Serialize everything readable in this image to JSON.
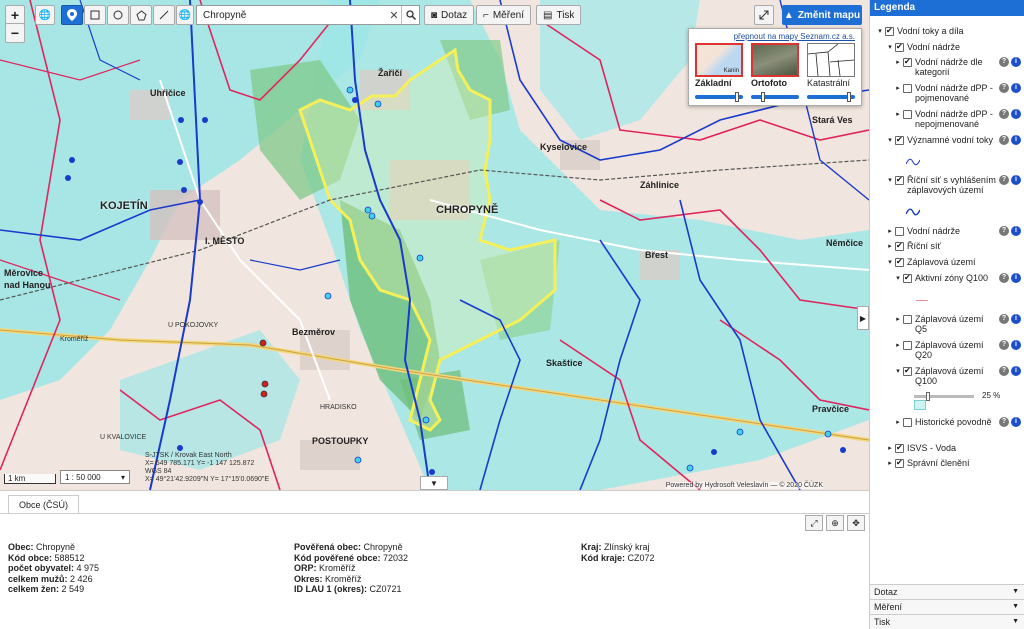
{
  "toolbar": {
    "zoom_in": "+",
    "zoom_out": "−",
    "search_value": "Chropyně",
    "query_label": "Dotaz",
    "measure_label": "Měření",
    "print_label": "Tisk",
    "change_map_label": "Změnit mapu"
  },
  "basemap": {
    "switch_link": "přepnout na mapy Seznam.cz a.s.",
    "options": [
      {
        "label": "Základní",
        "selected": true
      },
      {
        "label": "Ortofoto",
        "selected": true
      },
      {
        "label": "Katastrální",
        "selected": false
      }
    ],
    "thumb_text": "Kanin"
  },
  "map_labels": {
    "kojetin": "KOJETÍN",
    "chropyne": "CHROPYNĚ",
    "zarici": "Žařičí",
    "uhrickce": "Uhřičice",
    "kyselovice": "Kyselovice",
    "zalkovice": "Záhlinice",
    "brest": "Břest",
    "bezmerov": "Bezměrov",
    "postoupky": "POSTOUPKY",
    "kresnovice": "Kroměříž",
    "stara_ves": "Stará Ves",
    "nemcice": "Němčice",
    "pravcice": "Pravčice",
    "skastice": "Skaštice",
    "i_mesto": "I. MĚSTO",
    "merovice": "Měrovice",
    "hanou": "nad Hanou",
    "u_pokojovky": "U POKOJOVKY",
    "kvalovice": "U KVALOVICE",
    "postoupky_small": "Postoupky",
    "hradisko": "HRADISKO"
  },
  "map_status": {
    "scale_bar": "1 km",
    "scale_value": "1 : 50 000",
    "coord_line1": "S-JTSK / Krovak East North",
    "coord_line2": "X= 549 785.171 Y= -1 147 125.872",
    "coord_line3": "WGS 84",
    "coord_line4": "X= 49°21'42.9209\"N Y= 17°15'0.0690\"E",
    "attribution": "Powered by Hydrosoft Veleslavín — © 2020 ČÚZK"
  },
  "info_panel": {
    "tab_label": "Obce (ČSÚ)",
    "col1": [
      {
        "key": "Obec:",
        "value": "Chropyně"
      },
      {
        "key": "Kód obce:",
        "value": "588512"
      },
      {
        "key": "počet obyvatel:",
        "value": "4 975"
      },
      {
        "key": "celkem mužů:",
        "value": "2 426"
      },
      {
        "key": "celkem žen:",
        "value": "2 549"
      }
    ],
    "col2": [
      {
        "key": "Pověřená obec:",
        "value": "Chropyně"
      },
      {
        "key": "Kód pověřené obce:",
        "value": "72032"
      },
      {
        "key": "ORP:",
        "value": "Kroměříž"
      },
      {
        "key": "Okres:",
        "value": "Kroměříž"
      },
      {
        "key": "ID LAU 1 (okres):",
        "value": "CZ0721"
      }
    ],
    "col3": [
      {
        "key": "Kraj:",
        "value": "Zlínský kraj"
      },
      {
        "key": "Kód kraje:",
        "value": "CZ072"
      }
    ]
  },
  "legend": {
    "title": "Legenda",
    "items": [
      {
        "label": "Vodní toky a díla",
        "checked": true
      },
      {
        "label": "Vodní nádrže",
        "checked": true
      },
      {
        "label": "Vodní nádrže dle kategorií",
        "checked": true
      },
      {
        "label": "Vodní nádrže dPP - pojmenované",
        "checked": false
      },
      {
        "label": "Vodní nádrže dPP - nepojmenované",
        "checked": false
      },
      {
        "label": "Významné vodní toky",
        "checked": true
      },
      {
        "label": "Říční síť s vyhlášením záplavových území",
        "checked": true
      },
      {
        "label": "Vodní nádrže",
        "checked": false
      },
      {
        "label": "Říční síť",
        "checked": true
      },
      {
        "label": "Záplavová území",
        "checked": true
      },
      {
        "label": "Aktivní zóny Q100",
        "checked": true
      },
      {
        "label": "Záplavová území Q5",
        "checked": false
      },
      {
        "label": "Záplavová území Q20",
        "checked": false
      },
      {
        "label": "Záplavová území Q100",
        "checked": true
      },
      {
        "label": "Historické povodně",
        "checked": false
      },
      {
        "label": "ISVS - Voda",
        "checked": true
      },
      {
        "label": "Správní členění",
        "checked": true
      }
    ],
    "opacity_value": "25 %",
    "footer": [
      "Dotaz",
      "Měření",
      "Tisk"
    ]
  },
  "colors": {
    "accent": "#1d6fd6",
    "water_area": "#8fe3e3",
    "river": "#1a3acc",
    "boundary": "#e0245e",
    "highlight": "#f5f05a"
  }
}
